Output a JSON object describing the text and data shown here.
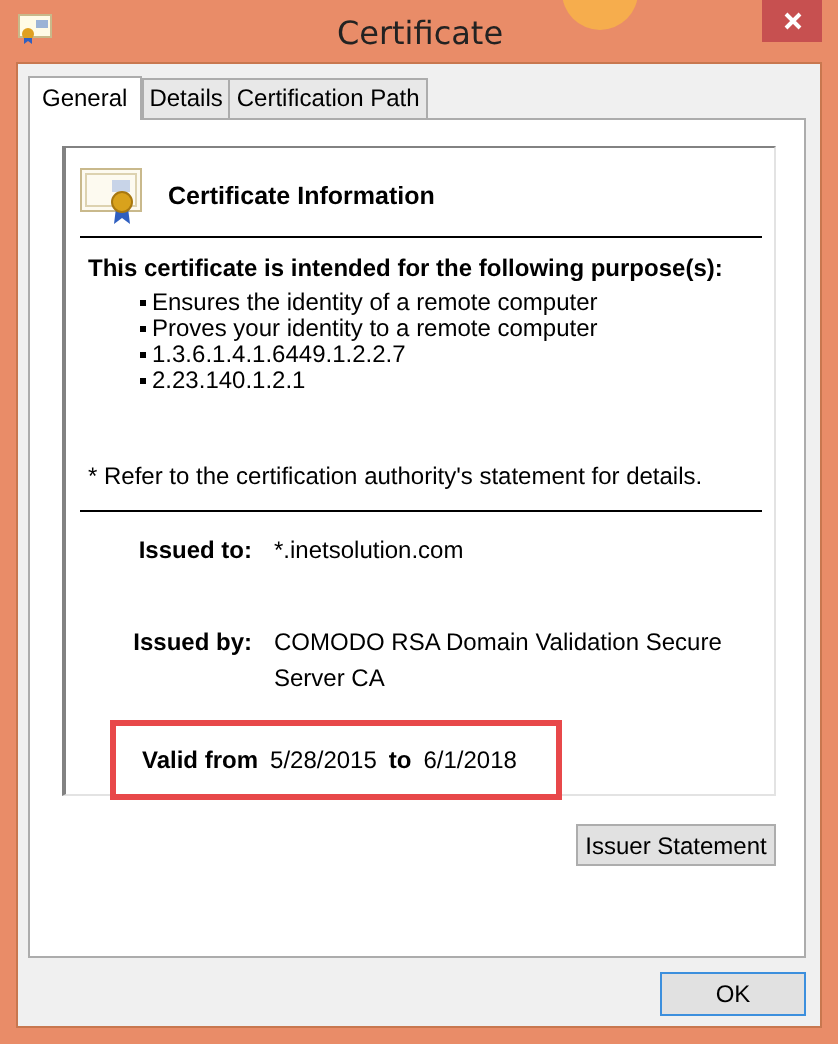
{
  "window": {
    "title": "Certificate"
  },
  "tabs": [
    {
      "label": "General",
      "selected": true
    },
    {
      "label": "Details",
      "selected": false
    },
    {
      "label": "Certification Path",
      "selected": false
    }
  ],
  "certificate_info": {
    "title": "Certificate Information",
    "purposes_heading": "This certificate is intended for the following purpose(s):",
    "purposes": [
      "Ensures the identity of a remote computer",
      "Proves your identity to a remote computer",
      "1.3.6.1.4.1.6449.1.2.2.7",
      "2.23.140.1.2.1"
    ],
    "note": "* Refer to the certification authority's statement for details."
  },
  "issued_to": {
    "label": "Issued to:",
    "value": "*.inetsolution.com"
  },
  "issued_by": {
    "label": "Issued by:",
    "value": "COMODO RSA Domain Validation Secure Server CA"
  },
  "validity": {
    "from_label": "Valid from",
    "from": "5/28/2015",
    "to_label": "to",
    "to": "6/1/2018",
    "highlighted": true
  },
  "buttons": [
    {
      "label": "Issuer Statement",
      "default": false
    },
    {
      "label": "OK",
      "default": true
    }
  ]
}
